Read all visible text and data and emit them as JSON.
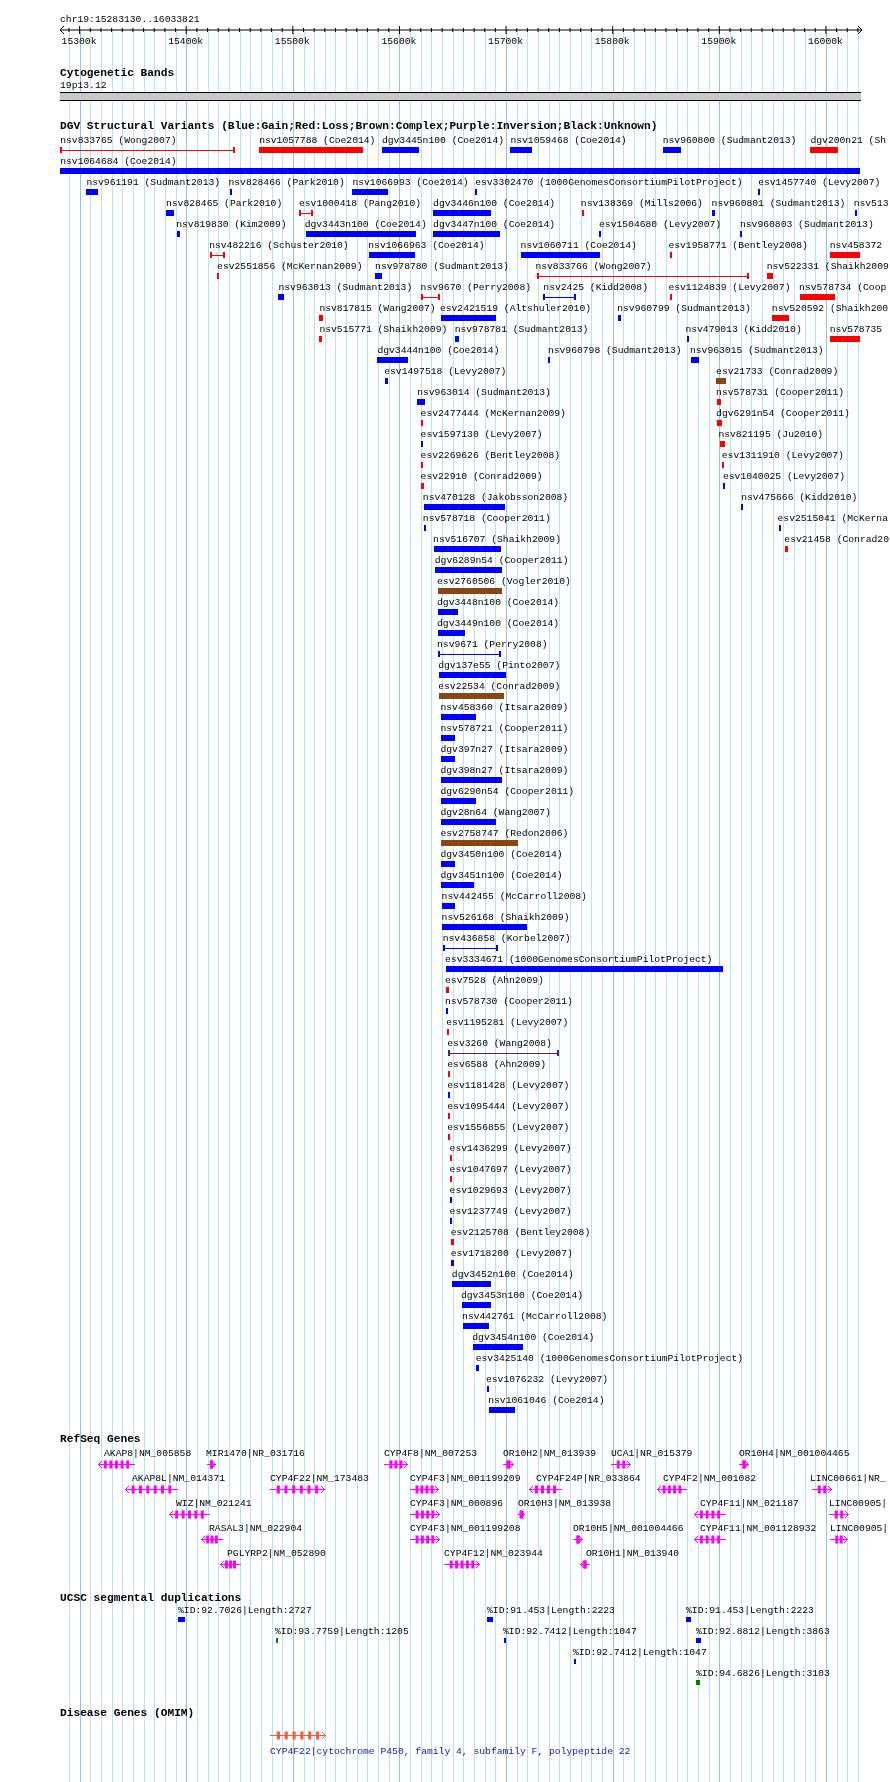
{
  "ruler": {
    "location": "chr19:15283130..16033821",
    "ticks": [
      "15300k",
      "15400k",
      "15500k",
      "15600k",
      "15700k",
      "15800k",
      "15900k",
      "16000k"
    ]
  },
  "tracks": [
    {
      "kind": "bands",
      "title": "Cytogenetic Bands",
      "features": [
        {
          "label": "19p13.12"
        }
      ]
    },
    {
      "kind": "variants",
      "title": "DGV Structural Variants (Blue:Gain;Red:Loss;Brown:Complex;Purple:Inversion;Black:Unknown)",
      "features": [
        {
          "label": "nsv833765 (Wong2007)",
          "kind": "span",
          "color": "#ff0000"
        },
        {
          "label": "nsv1057788 (Coe2014)",
          "kind": "bar",
          "color": "#ff0000"
        },
        {
          "label": "dgv3445n100 (Coe2014)",
          "kind": "bar",
          "color": "#0000ff"
        },
        {
          "label": "nsv1059468 (Coe2014)",
          "kind": "bar",
          "color": "#0000ff"
        },
        {
          "label": "nsv960800 (Sudmant2013)",
          "kind": "bar",
          "color": "#0000ff"
        },
        {
          "label": "dgv200n21 (Sh",
          "kind": "bar",
          "color": "#ff0000"
        },
        {
          "label": "nsv1064684 (Coe2014)",
          "kind": "bar",
          "color": "#0000ff"
        },
        {
          "label": "nsv961191 (Sudmant2013)",
          "kind": "bar",
          "color": "#0000ff"
        },
        {
          "label": "nsv828466 (Park2010)",
          "kind": "bar",
          "color": "#0000ff"
        },
        {
          "label": "nsv1066993 (Coe2014)",
          "kind": "bar",
          "color": "#0000ff"
        },
        {
          "label": "esv3302470 (1000GenomesConsortiumPilotProject)",
          "kind": "bar",
          "color": "#0000ff"
        },
        {
          "label": "esv1457740 (Levy2007)",
          "kind": "bar",
          "color": "#0000ff"
        },
        {
          "label": "nsv828465 (Park2010)",
          "kind": "bar",
          "color": "#0000ff"
        },
        {
          "label": "esv1000418 (Pang2010)",
          "kind": "span",
          "color": "#ff0000"
        },
        {
          "label": "dgv3446n100 (Coe2014)",
          "kind": "bar",
          "color": "#0000ff"
        },
        {
          "label": "nsv138369 (Mills2006)",
          "kind": "bar",
          "color": "#ff0000"
        },
        {
          "label": "nsv960801 (Sudmant2013)",
          "kind": "bar",
          "color": "#0000ff"
        },
        {
          "label": "nsv513",
          "kind": "bar",
          "color": "#0000ff"
        },
        {
          "label": "nsv819830 (Kim2009)",
          "kind": "bar",
          "color": "#0000ff"
        },
        {
          "label": "dgv3443n100 (Coe2014)",
          "kind": "bar",
          "color": "#0000ff"
        },
        {
          "label": "dgv3447n100 (Coe2014)",
          "kind": "bar",
          "color": "#0000ff"
        },
        {
          "label": "esv1504680 (Levy2007)",
          "kind": "bar",
          "color": "#0000ff"
        },
        {
          "label": "nsv960803 (Sudmant2013)",
          "kind": "bar",
          "color": "#0000ff"
        },
        {
          "label": "nsv482216 (Schuster2010)",
          "kind": "span",
          "color": "#ff0000"
        },
        {
          "label": "nsv1066963 (Coe2014)",
          "kind": "bar",
          "color": "#0000ff"
        },
        {
          "label": "nsv1060711 (Coe2014)",
          "kind": "bar",
          "color": "#0000ff"
        },
        {
          "label": "esv1958771 (Bentley2008)",
          "kind": "bar",
          "color": "#ff0000"
        },
        {
          "label": "nsv458372",
          "kind": "bar",
          "color": "#ff0000"
        },
        {
          "label": "esv2551856 (McKernan2009)",
          "kind": "bar",
          "color": "#ff0000"
        },
        {
          "label": "nsv978780 (Sudmant2013)",
          "kind": "bar",
          "color": "#0000ff"
        },
        {
          "label": "nsv833766 (Wong2007)",
          "kind": "span",
          "color": "#ff0000"
        },
        {
          "label": "nsv522331 (Shaikh2009",
          "kind": "bar",
          "color": "#ff0000"
        },
        {
          "label": "nsv963013 (Sudmant2013)",
          "kind": "bar",
          "color": "#0000ff"
        },
        {
          "label": "nsv9670 (Perry2008)",
          "kind": "span",
          "color": "#ff0000"
        },
        {
          "label": "nsv2425 (Kidd2008)",
          "kind": "span",
          "color": "#0000ff"
        },
        {
          "label": "esv1124839 (Levy2007)",
          "kind": "bar",
          "color": "#ff0000"
        },
        {
          "label": "nsv578734 (Coop",
          "kind": "bar",
          "color": "#ff0000"
        },
        {
          "label": "nsv817815 (Wang2007)",
          "kind": "bar",
          "color": "#ff0000"
        },
        {
          "label": "esv2421519 (Altshuler2010)",
          "kind": "bar",
          "color": "#0000ff"
        },
        {
          "label": "nsv960799 (Sudmant2013)",
          "kind": "bar",
          "color": "#0000ff"
        },
        {
          "label": "nsv520592 (Shaikh200",
          "kind": "bar",
          "color": "#ff0000"
        },
        {
          "label": "nsv515771 (Shaikh2009)",
          "kind": "bar",
          "color": "#ff0000"
        },
        {
          "label": "nsv978781 (Sudmant2013)",
          "kind": "bar",
          "color": "#0000ff"
        },
        {
          "label": "nsv479013 (Kidd2010)",
          "kind": "bar",
          "color": "#0000ff"
        },
        {
          "label": "nsv578735",
          "kind": "bar",
          "color": "#ff0000"
        },
        {
          "label": "dgv3444n100 (Coe2014)",
          "kind": "bar",
          "color": "#0000ff"
        },
        {
          "label": "nsv960798 (Sudmant2013)",
          "kind": "bar",
          "color": "#0000ff"
        },
        {
          "label": "nsv963015 (Sudmant2013)",
          "kind": "bar",
          "color": "#0000ff"
        },
        {
          "label": "esv1497518 (Levy2007)",
          "kind": "bar",
          "color": "#0000ff"
        },
        {
          "label": "esv21733 (Conrad2009)",
          "kind": "bar",
          "color": "#8b4513"
        },
        {
          "label": "nsv963014 (Sudmant2013)",
          "kind": "bar",
          "color": "#0000ff"
        },
        {
          "label": "nsv578731 (Cooper2011)",
          "kind": "bar",
          "color": "#ff0000"
        },
        {
          "label": "esv2477444 (McKernan2009)",
          "kind": "bar",
          "color": "#ff0000"
        },
        {
          "label": "dgv6291n54 (Cooper2011)",
          "kind": "bar",
          "color": "#ff0000"
        },
        {
          "label": "esv1597130 (Levy2007)",
          "kind": "bar",
          "color": "#0000ff"
        },
        {
          "label": "nsv821195 (Ju2010)",
          "kind": "bar",
          "color": "#ff0000"
        },
        {
          "label": "esv2269626 (Bentley2008)",
          "kind": "bar",
          "color": "#ff0000"
        },
        {
          "label": "esv1311910 (Levy2007)",
          "kind": "bar",
          "color": "#ff0000"
        },
        {
          "label": "esv22910 (Conrad2009)",
          "kind": "bar",
          "color": "#ff0000"
        },
        {
          "label": "esv1040025 (Levy2007)",
          "kind": "bar",
          "color": "#0000ff"
        },
        {
          "label": "nsv470128 (Jakobsson2008)",
          "kind": "bar",
          "color": "#0000ff"
        },
        {
          "label": "nsv475666 (Kidd2010)",
          "kind": "bar",
          "color": "#0000ff"
        },
        {
          "label": "nsv578718 (Cooper2011)",
          "kind": "bar",
          "color": "#0000ff"
        },
        {
          "label": "esv2515041 (McKerna",
          "kind": "bar",
          "color": "#0000ff"
        },
        {
          "label": "nsv516707 (Shaikh2009)",
          "kind": "bar",
          "color": "#0000ff"
        },
        {
          "label": "esv21458 (Conrad20",
          "kind": "bar",
          "color": "#ff0000"
        },
        {
          "label": "dgv6289n54 (Cooper2011)",
          "kind": "bar",
          "color": "#0000ff"
        },
        {
          "label": "esv2760506 (Vogler2010)",
          "kind": "bar",
          "color": "#8b4513"
        },
        {
          "label": "dgv3448n100 (Coe2014)",
          "kind": "bar",
          "color": "#0000ff"
        },
        {
          "label": "dgv3449n100 (Coe2014)",
          "kind": "bar",
          "color": "#0000ff"
        },
        {
          "label": "nsv9671 (Perry2008)",
          "kind": "span",
          "color": "#0000ff"
        },
        {
          "label": "dgv137e55 (Pinto2007)",
          "kind": "bar",
          "color": "#0000ff"
        },
        {
          "label": "esv22534 (Conrad2009)",
          "kind": "bar",
          "color": "#8b4513"
        },
        {
          "label": "nsv458360 (Itsara2009)",
          "kind": "bar",
          "color": "#0000ff"
        },
        {
          "label": "nsv578721 (Cooper2011)",
          "kind": "bar",
          "color": "#0000ff"
        },
        {
          "label": "dgv397n27 (Itsara2009)",
          "kind": "bar",
          "color": "#0000ff"
        },
        {
          "label": "dgv398n27 (Itsara2009)",
          "kind": "bar",
          "color": "#0000ff"
        },
        {
          "label": "dgv6290n54 (Cooper2011)",
          "kind": "bar",
          "color": "#0000ff"
        },
        {
          "label": "dgv28n64 (Wang2007)",
          "kind": "bar",
          "color": "#0000ff"
        },
        {
          "label": "esv2758747 (Redon2006)",
          "kind": "bar",
          "color": "#8b4513"
        },
        {
          "label": "dgv3450n100 (Coe2014)",
          "kind": "bar",
          "color": "#0000ff"
        },
        {
          "label": "dgv3451n100 (Coe2014)",
          "kind": "bar",
          "color": "#0000ff"
        },
        {
          "label": "nsv442455 (McCarroll2008)",
          "kind": "bar",
          "color": "#0000ff"
        },
        {
          "label": "nsv526168 (Shaikh2009)",
          "kind": "bar",
          "color": "#0000ff"
        },
        {
          "label": "nsv436858 (Korbel2007)",
          "kind": "span",
          "color": "#0000ff"
        },
        {
          "label": "esv3334671 (1000GenomesConsortiumPilotProject)",
          "kind": "bar",
          "color": "#0000ff"
        },
        {
          "label": "esv7528 (Ahn2009)",
          "kind": "bar",
          "color": "#ff0000"
        },
        {
          "label": "nsv578730 (Cooper2011)",
          "kind": "bar",
          "color": "#0000ff"
        },
        {
          "label": "esv1195281 (Levy2007)",
          "kind": "bar",
          "color": "#ff0000"
        },
        {
          "label": "esv3260 (Wang2008)",
          "kind": "span",
          "color": "#551a8b"
        },
        {
          "label": "esv6588 (Ahn2009)",
          "kind": "bar",
          "color": "#ff0000"
        },
        {
          "label": "esv1181428 (Levy2007)",
          "kind": "bar",
          "color": "#0000ff"
        },
        {
          "label": "esv1095444 (Levy2007)",
          "kind": "bar",
          "color": "#ff0000"
        },
        {
          "label": "esv1556855 (Levy2007)",
          "kind": "bar",
          "color": "#ff0000"
        },
        {
          "label": "esv1436299 (Levy2007)",
          "kind": "bar",
          "color": "#ff0000"
        },
        {
          "label": "esv1047697 (Levy2007)",
          "kind": "bar",
          "color": "#ff0000"
        },
        {
          "label": "esv1029693 (Levy2007)",
          "kind": "bar",
          "color": "#0000ff"
        },
        {
          "label": "esv1237749 (Levy2007)",
          "kind": "bar",
          "color": "#0000ff"
        },
        {
          "label": "esv2125708 (Bentley2008)",
          "kind": "bar",
          "color": "#ff0000"
        },
        {
          "label": "esv1718200 (Levy2007)",
          "kind": "bar",
          "color": "#0000ff"
        },
        {
          "label": "dgv3452n100 (Coe2014)",
          "kind": "bar",
          "color": "#0000ff"
        },
        {
          "label": "dgv3453n100 (Coe2014)",
          "kind": "bar",
          "color": "#0000ff"
        },
        {
          "label": "nsv442761 (McCarroll2008)",
          "kind": "bar",
          "color": "#0000ff"
        },
        {
          "label": "dgv3454n100 (Coe2014)",
          "kind": "bar",
          "color": "#0000ff"
        },
        {
          "label": "esv3425140 (1000GenomesConsortiumPilotProject)",
          "kind": "bar",
          "color": "#0000ff"
        },
        {
          "label": "esv1076232 (Levy2007)",
          "kind": "bar",
          "color": "#0000ff"
        },
        {
          "label": "nsv1061046 (Coe2014)",
          "kind": "bar",
          "color": "#0000ff"
        }
      ]
    },
    {
      "kind": "genes",
      "title": "RefSeq Genes",
      "features": [
        {
          "label": "AKAP8|NM_005858",
          "reverse": true
        },
        {
          "label": "MIR1470|NR_031716",
          "reverse": false
        },
        {
          "label": "CYP4F8|NM_007253",
          "reverse": false
        },
        {
          "label": "OR10H2|NM_013939",
          "reverse": false
        },
        {
          "label": "UCA1|NR_015379",
          "reverse": false
        },
        {
          "label": "OR10H4|NM_001004465",
          "reverse": false
        },
        {
          "label": "AKAP8L|NM_014371",
          "reverse": true
        },
        {
          "label": "CYP4F22|NM_173483",
          "reverse": false
        },
        {
          "label": "CYP4F3|NM_001199209",
          "reverse": false
        },
        {
          "label": "CYP4F24P|NR_033864",
          "reverse": true
        },
        {
          "label": "CYP4F2|NM_001082",
          "reverse": true
        },
        {
          "label": "LINC00661|NR_",
          "reverse": false
        },
        {
          "label": "WIZ|NM_021241",
          "reverse": true
        },
        {
          "label": "CYP4F3|NM_000896",
          "reverse": false
        },
        {
          "label": "OR10H3|NM_013938",
          "reverse": false
        },
        {
          "label": "CYP4F11|NM_021187",
          "reverse": true
        },
        {
          "label": "LINC00905|",
          "reverse": false
        },
        {
          "label": "RASAL3|NM_022904",
          "reverse": true
        },
        {
          "label": "CYP4F3|NM_001199208",
          "reverse": false
        },
        {
          "label": "OR10H5|NM_001004466",
          "reverse": false
        },
        {
          "label": "CYP4F11|NM_001128932",
          "reverse": true
        },
        {
          "label": "LINC00905|",
          "reverse": false
        },
        {
          "label": "PGLYRP2|NM_052890",
          "reverse": true
        },
        {
          "label": "CYP4F12|NM_023944",
          "reverse": false
        },
        {
          "label": "OR10H1|NM_013940",
          "reverse": true
        }
      ]
    },
    {
      "kind": "segdups",
      "title": "UCSC segmental duplications",
      "features": [
        {
          "label": "%ID:92.7026|Length:2727",
          "color": "#0000ff"
        },
        {
          "label": "%ID:91.453|Length:2223",
          "color": "#0000ff"
        },
        {
          "label": "%ID:91.453|Length:2223",
          "color": "#0000ff"
        },
        {
          "label": "%ID:93.7759|Length:1205",
          "color": "#008000"
        },
        {
          "label": "%ID:92.7412|Length:1047",
          "color": "#0000ff"
        },
        {
          "label": "%ID:92.8812|Length:3863",
          "color": "#0000ff"
        },
        {
          "label": "%ID:92.7412|Length:1047",
          "color": "#0000ff"
        },
        {
          "label": "%ID:94.6826|Length:3103",
          "color": "#008000"
        }
      ]
    },
    {
      "kind": "disease",
      "title": "Disease Genes (OMIM)",
      "features": [
        {
          "label": "CYP4F22|cytochrome P450, family 4, subfamily F, polypeptide 22",
          "reverse": false
        }
      ]
    }
  ]
}
